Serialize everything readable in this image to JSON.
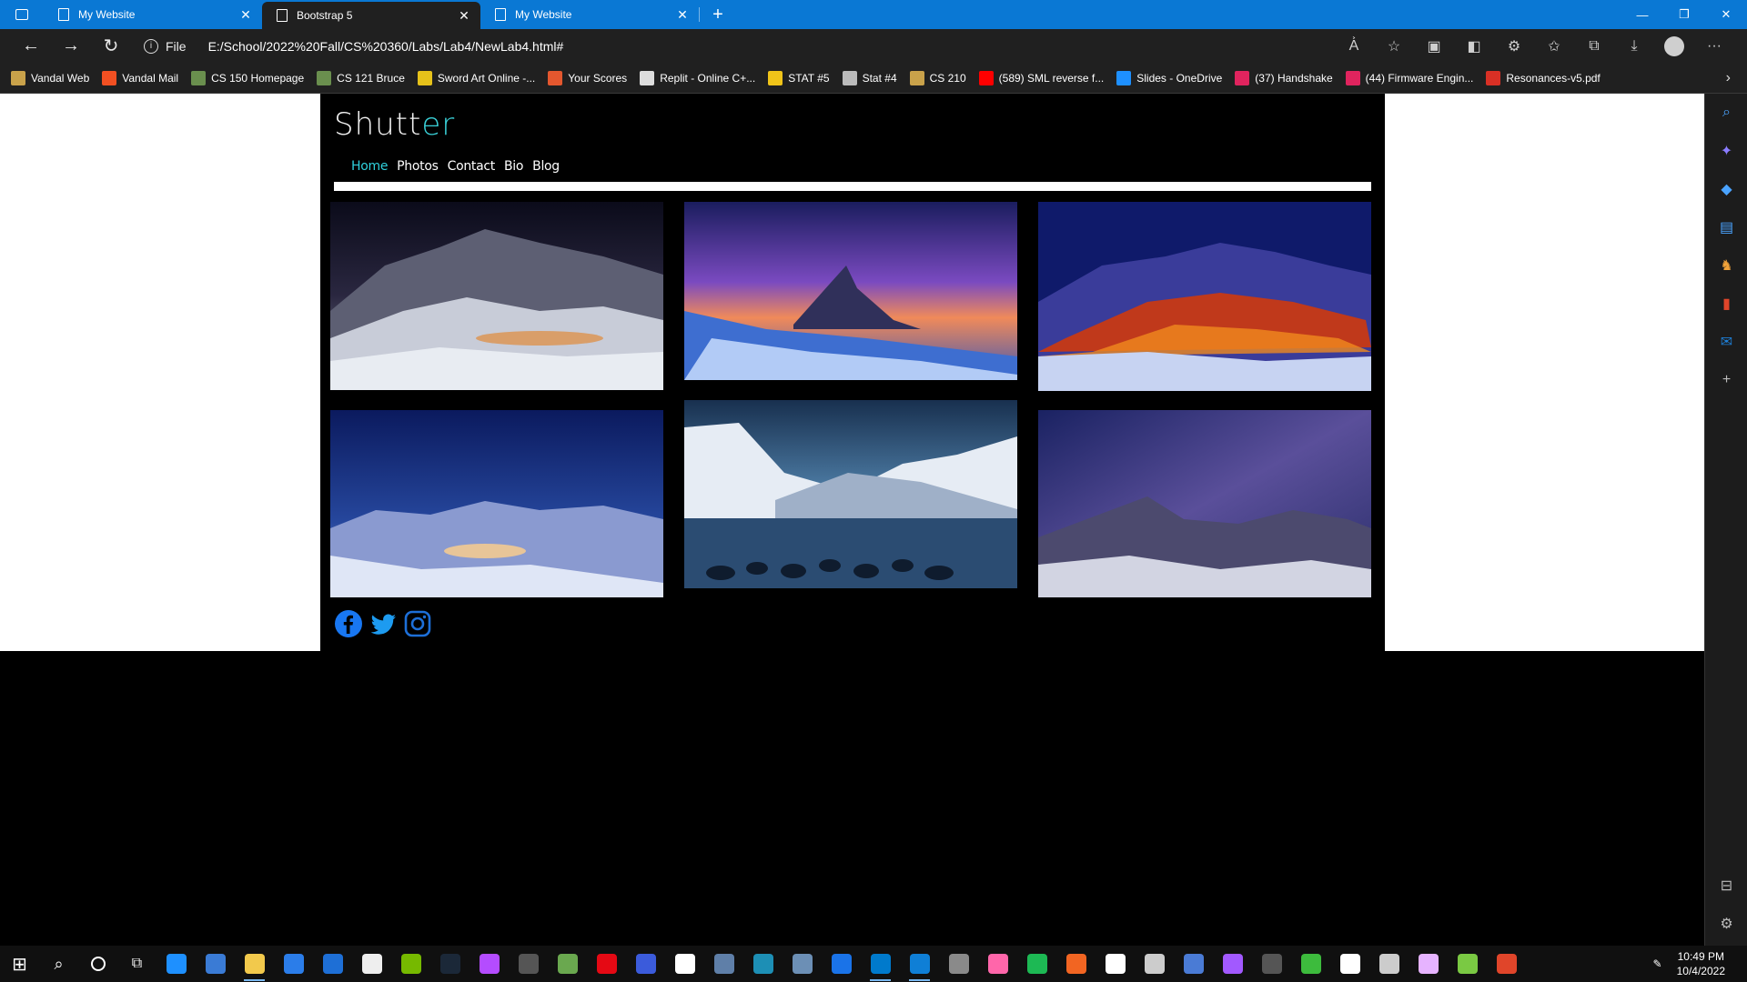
{
  "browser": {
    "tabs": [
      {
        "title": "My Website",
        "active": false
      },
      {
        "title": "Bootstrap 5",
        "active": true
      },
      {
        "title": "My Website",
        "active": false
      }
    ],
    "new_tab": "+",
    "address": {
      "scheme": "File",
      "url": "E:/School/2022%20Fall/CS%20360/Labs/Lab4/NewLab4.html#"
    },
    "bookmarks": [
      {
        "label": "Vandal Web",
        "color": "#c9a24a"
      },
      {
        "label": "Vandal Mail",
        "color": "#f25022"
      },
      {
        "label": "CS 150 Homepage",
        "color": "#6a8f4e"
      },
      {
        "label": "CS 121 Bruce",
        "color": "#6a8f4e"
      },
      {
        "label": "Sword Art Online -...",
        "color": "#e6c21a"
      },
      {
        "label": "Your Scores",
        "color": "#e4572e"
      },
      {
        "label": "Replit - Online C+...",
        "color": "#dddddd"
      },
      {
        "label": "STAT #5",
        "color": "#f0c419"
      },
      {
        "label": "Stat #4",
        "color": "#bbbbbb"
      },
      {
        "label": "CS 210",
        "color": "#c9a24a"
      },
      {
        "label": "(589) SML reverse f...",
        "color": "#ff0000"
      },
      {
        "label": "Slides - OneDrive",
        "color": "#1e90ff"
      },
      {
        "label": "(37) Handshake",
        "color": "#e0245e"
      },
      {
        "label": "(44) Firmware Engin...",
        "color": "#e0245e"
      },
      {
        "label": "Resonances-v5.pdf",
        "color": "#d93025"
      }
    ]
  },
  "site": {
    "brand_main": "Shutt",
    "brand_accent": "er",
    "nav": [
      "Home",
      "Photos",
      "Contact",
      "Bio",
      "Blog"
    ],
    "active_nav": "Home",
    "social": [
      "facebook-icon",
      "twitter-icon",
      "instagram-icon"
    ],
    "accent_color": "#2fd0dc"
  },
  "taskbar": {
    "time": "10:49 PM",
    "date": "10/4/2022"
  }
}
